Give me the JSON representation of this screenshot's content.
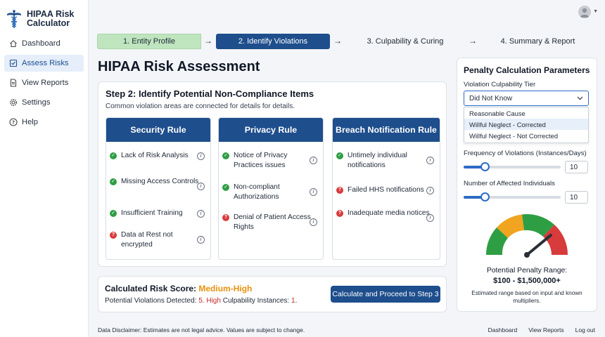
{
  "app": {
    "name_line1": "HIPAA Risk",
    "name_line2": "Calculator"
  },
  "sidebar": {
    "items": [
      {
        "label": "Dashboard",
        "icon": "home-icon",
        "active": false
      },
      {
        "label": "Assess Risks",
        "icon": "checklist-icon",
        "active": true
      },
      {
        "label": "View Reports",
        "icon": "document-icon",
        "active": false
      },
      {
        "label": "Settings",
        "icon": "gear-icon",
        "active": false
      },
      {
        "label": "Help",
        "icon": "help-icon",
        "active": false
      }
    ]
  },
  "stepper": {
    "steps": [
      "1. Entity Profile",
      "2. Identify Violations",
      "3. Culpability & Curing",
      "4. Summary & Report"
    ],
    "arrow": "→"
  },
  "page": {
    "title": "HIPAA Risk Assessment"
  },
  "step_card": {
    "heading": "Step 2: Identify Potential Non-Compliance Items",
    "sub": "Common violation areas are connected for details for details.",
    "columns": [
      {
        "title": "Security Rule",
        "items": [
          {
            "text": "Lack of Risk Analysis",
            "status": "ok"
          },
          {
            "text": "Missing Access Controls",
            "status": "ok"
          },
          {
            "text": "Insufficient Training",
            "status": "ok"
          },
          {
            "text": "Data at Rest not encrypted",
            "status": "bad"
          }
        ]
      },
      {
        "title": "Privacy Rule",
        "items": [
          {
            "text": "Notice of Privacy Practices issues",
            "status": "ok"
          },
          {
            "text": "Non-compliant Authorizations",
            "status": "ok"
          },
          {
            "text": "Denial of Patient Access Rights",
            "status": "bad"
          }
        ]
      },
      {
        "title": "Breach Notification Rule",
        "items": [
          {
            "text": "Untimely individual notifications",
            "status": "ok"
          },
          {
            "text": "Failed HHS notifications",
            "status": "bad"
          },
          {
            "text": "Inadequate media notices",
            "status": "bad"
          }
        ]
      }
    ]
  },
  "score": {
    "label": "Calculated Risk Score: ",
    "value": "Medium-High",
    "violations_label": "Potential Violations Detected: ",
    "violations_count": "5",
    "high_label": "High",
    "culp_label": " Culpability Instances: ",
    "culp_count": "1",
    "button": "Calculate and Proceed to Step 3"
  },
  "footer": {
    "disclaimer": "Data Disclaimer: Estimates are not legal advice. Values are subject to change.",
    "links": [
      "Dashboard",
      "View Reports",
      "Log out"
    ]
  },
  "panel": {
    "title": "Penalty Calculation Parameters",
    "tier_label": "Violation Culpability Tier",
    "tier_selected": "Did Not Know",
    "tier_options": [
      "Reasonable Cause",
      "Willful Neglect - Corrected",
      "Willful Neglect - Not Corrected"
    ],
    "tier_highlighted": 1,
    "frequency_label": "Frequency of Violations (Instances/Days)",
    "frequency_value": "10",
    "frequency_fraction": 0.22,
    "affected_label": "Number of Affected Individuals",
    "affected_value": "10",
    "affected_fraction": 0.22,
    "gauge_fraction": 0.78,
    "range_label": "Potential Penalty Range:",
    "range_value": "$100 - $1,500,000+",
    "range_note": "Estimated range based on input and known multipliers."
  },
  "colors": {
    "primary": "#1e4e8c",
    "accent": "#2d6bc4",
    "success": "#2e9e44",
    "danger": "#d83b3b",
    "warning": "#e8910d",
    "step_done": "#bfe5bf"
  }
}
